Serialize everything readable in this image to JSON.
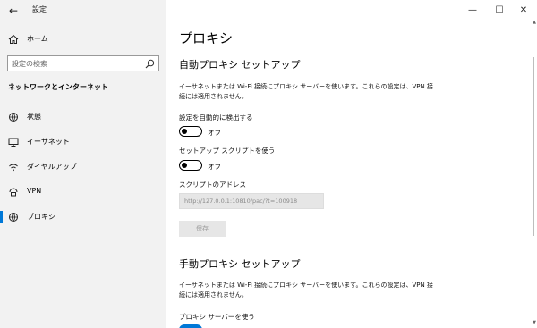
{
  "app": {
    "title": "設定"
  },
  "window": {
    "minimize": "—",
    "maximize": "☐",
    "close": "✕"
  },
  "sidebar": {
    "home_label": "ホーム",
    "search_placeholder": "設定の検索",
    "section_heading": "ネットワークとインターネット",
    "items": [
      {
        "label": "状態",
        "icon": "globe-status-icon"
      },
      {
        "label": "イーサネット",
        "icon": "monitor-ethernet-icon"
      },
      {
        "label": "ダイヤルアップ",
        "icon": "dialup-icon"
      },
      {
        "label": "VPN",
        "icon": "vpn-icon"
      },
      {
        "label": "プロキシ",
        "icon": "globe-icon",
        "active": true
      }
    ]
  },
  "main": {
    "page_title": "プロキシ",
    "auto": {
      "heading": "自動プロキシ セットアップ",
      "description": "イーサネットまたは Wi-Fi 接続にプロキシ サーバーを使います。これらの設定は、VPN 接続には適用されません。",
      "detect_label": "設定を自動的に検出する",
      "detect_state": "オフ",
      "script_label": "セットアップ スクリプトを使う",
      "script_state": "オフ",
      "address_label": "スクリプトのアドレス",
      "address_value": "http://127.0.0.1:10810/pac/?t=100918",
      "save_label": "保存"
    },
    "manual": {
      "heading": "手動プロキシ セットアップ",
      "description": "イーサネットまたは Wi-Fi 接続にプロキシ サーバーを使います。これらの設定は、VPN 接続には適用されません。",
      "use_proxy_label": "プロキシ サーバーを使う"
    }
  },
  "colors": {
    "accent": "#0078d7",
    "sidebar_bg": "#f2f2f2"
  }
}
